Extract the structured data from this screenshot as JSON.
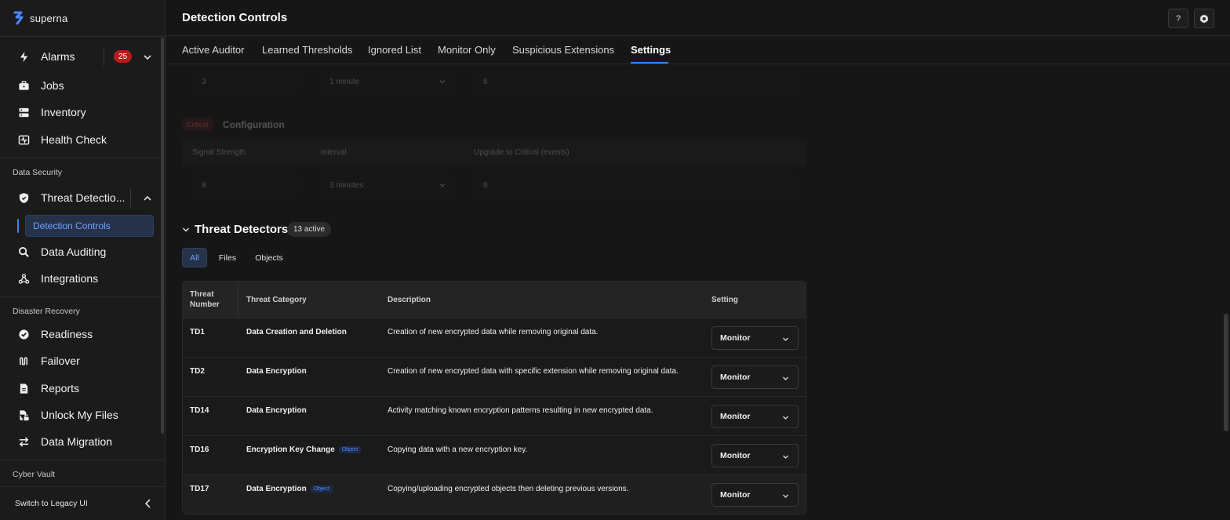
{
  "app": {
    "brand": "superna"
  },
  "sidebar": {
    "alarms": {
      "label": "Alarms",
      "count": "25"
    },
    "top_items": [
      {
        "label": "Jobs",
        "icon": "briefcase-icon"
      },
      {
        "label": "Inventory",
        "icon": "server-icon"
      },
      {
        "label": "Health Check",
        "icon": "heartbeat-icon"
      }
    ],
    "sections": {
      "data_security": "Data Security",
      "disaster_recovery": "Disaster Recovery",
      "cyber_vault": "Cyber Vault"
    },
    "threat_detection": {
      "label": "Threat Detectio...",
      "sub_active": "Detection Controls"
    },
    "ds_items": [
      {
        "label": "Data Auditing",
        "icon": "search-icon"
      },
      {
        "label": "Integrations",
        "icon": "webhook-icon"
      }
    ],
    "dr_items": [
      {
        "label": "Readiness",
        "icon": "check-circle-icon"
      },
      {
        "label": "Failover",
        "icon": "failover-icon"
      },
      {
        "label": "Reports",
        "icon": "report-icon"
      },
      {
        "label": "Unlock My Files",
        "icon": "unlock-file-icon"
      },
      {
        "label": "Data Migration",
        "icon": "swap-icon"
      }
    ],
    "legacy": "Switch to Legacy UI"
  },
  "header": {
    "title": "Detection Controls",
    "help": "?"
  },
  "tabs": [
    {
      "label": "Active Auditor"
    },
    {
      "label": "Learned Thresholds"
    },
    {
      "label": "Ignored List"
    },
    {
      "label": "Monitor Only"
    },
    {
      "label": "Suspicious Extensions"
    },
    {
      "label": "Settings",
      "active": true
    }
  ],
  "config_top": {
    "signal": "3",
    "interval": "1 minute",
    "upgrade": "8"
  },
  "critical": {
    "badge": "Critical",
    "title": "Configuration",
    "columns": [
      "Signal Strength",
      "Interval",
      "Upgrade to Critical (events)"
    ],
    "signal": "8",
    "interval": "3 minutes",
    "upgrade": "8"
  },
  "detectors": {
    "title": "Threat Detectors",
    "active_count": "13 active",
    "filters": [
      "All",
      "Files",
      "Objects"
    ],
    "columns": {
      "number_line1": "Threat",
      "number_line2": "Number",
      "category": "Threat Category",
      "description": "Description",
      "setting": "Setting"
    },
    "rows": [
      {
        "number": "TD1",
        "category": "Data Creation and Deletion",
        "tag": "",
        "description": "Creation of new encrypted data while removing original data.",
        "setting": "Monitor"
      },
      {
        "number": "TD2",
        "category": "Data Encryption",
        "tag": "",
        "description": "Creation of new encrypted data with specific extension while removing original data.",
        "setting": "Monitor"
      },
      {
        "number": "TD14",
        "category": "Data Encryption",
        "tag": "",
        "description": "Activity matching known encryption patterns resulting in new encrypted data.",
        "setting": "Monitor"
      },
      {
        "number": "TD16",
        "category": "Encryption Key Change",
        "tag": "Object",
        "description": "Copying data with a new encryption key.",
        "setting": "Monitor"
      },
      {
        "number": "TD17",
        "category": "Data Encryption",
        "tag": "Object",
        "description": "Copying/uploading encrypted objects then deleting previous versions.",
        "setting": "Monitor"
      }
    ]
  },
  "colors": {
    "accent": "#3b82f6",
    "badge_red": "#b71c1c",
    "bg": "#161616"
  }
}
